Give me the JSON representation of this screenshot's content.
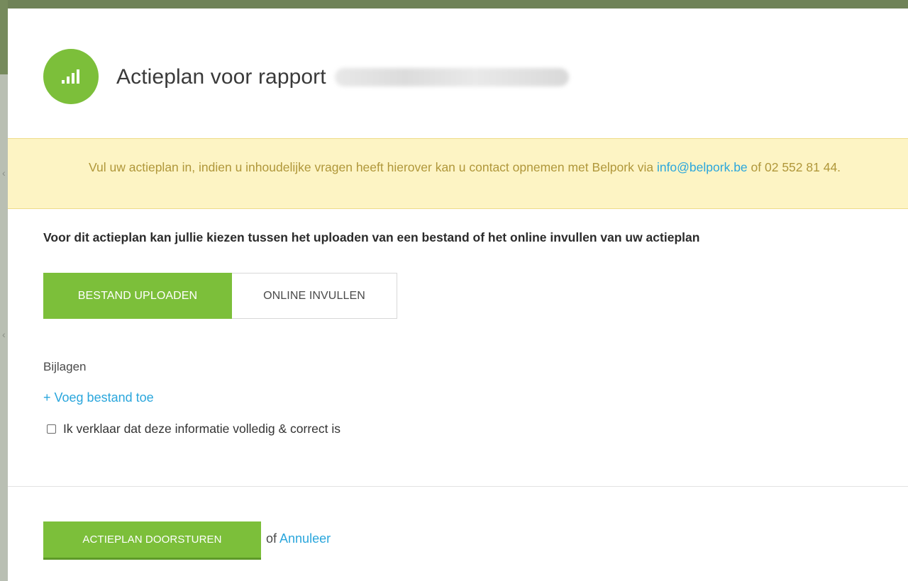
{
  "header": {
    "title": "Actieplan voor rapport",
    "logo_icon": "signal-bars-icon",
    "accent_color": "#7cbf3a"
  },
  "notice": {
    "text_before": "Vul uw actieplan in, indien u inhoudelijke vragen heeft hierover kan u contact opnemen met Belpork via ",
    "email": "info@belpork.be",
    "text_after": " of 02 552 81 44."
  },
  "intro": "Voor dit actieplan kan jullie kiezen tussen het uploaden van een bestand of het online invullen van uw actieplan",
  "mode_toggle": {
    "options": [
      {
        "label": "BESTAND UPLOADEN",
        "selected": true
      },
      {
        "label": "ONLINE INVULLEN",
        "selected": false
      }
    ]
  },
  "attachments": {
    "label": "Bijlagen",
    "add_link": "+ Voeg bestand toe"
  },
  "declaration": {
    "label": "Ik verklaar dat deze informatie volledig & correct is",
    "checked": false
  },
  "footer": {
    "submit_label": "ACTIEPLAN DOORSTUREN",
    "or_text": "of ",
    "cancel_label": "Annuleer"
  }
}
